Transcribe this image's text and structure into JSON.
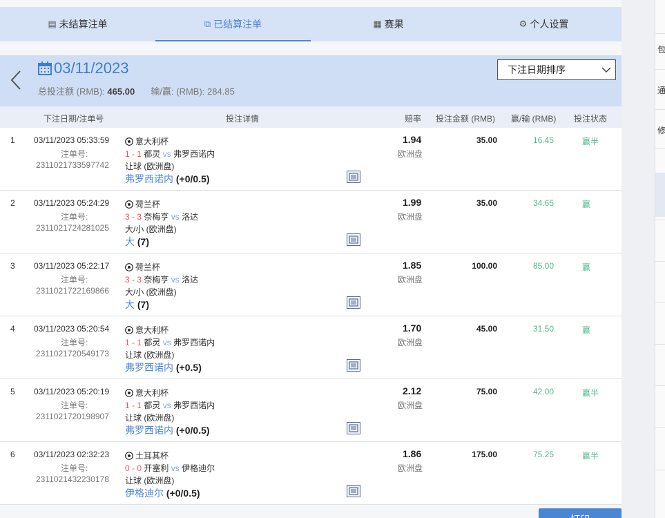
{
  "tabs": [
    {
      "label": "未结算注单",
      "icon": "unsettled-bets-icon",
      "active": false
    },
    {
      "label": "已结算注单",
      "icon": "settled-bets-icon",
      "active": true
    },
    {
      "label": "赛果",
      "icon": "results-icon",
      "active": false
    },
    {
      "label": "个人设置",
      "icon": "gear-icon",
      "active": false
    }
  ],
  "header": {
    "date": "03/11/2023",
    "total_label": "总投注额 (RMB):",
    "total_value": "465.00",
    "winloss_label": "输/赢: (RMB):",
    "winloss_value": "284.85",
    "sort_label": "下注日期排序"
  },
  "columns": {
    "date_no": "下注日期/注单号",
    "details": "投注详情",
    "odds": "赔率",
    "stake": "投注金额 (RMB)",
    "winloss": "赢/输 (RMB)",
    "status": "投注状态"
  },
  "bet_no_label": "注单号:",
  "rows": [
    {
      "index": "1",
      "datetime": "03/11/2023 05:33:59",
      "bet_no": "2311021733597742",
      "league": "意大利杯",
      "score": "1 - 1",
      "home": "都灵",
      "vs": "vs",
      "away": "弗罗西诺内",
      "market": "让球 (欧洲盘)",
      "pick": "弗罗西诺内",
      "line": "(+0/0.5)",
      "odds": "1.94",
      "odds_type": "欧洲盘",
      "stake": "35.00",
      "winloss": "16.45",
      "status": "赢半"
    },
    {
      "index": "2",
      "datetime": "03/11/2023 05:24:29",
      "bet_no": "2311021724281025",
      "league": "荷兰杯",
      "score": "3 - 3",
      "home": "奈梅亨",
      "vs": "vs",
      "away": "洛达",
      "market": "大/小 (欧洲盘)",
      "pick": "大",
      "line": "(7)",
      "odds": "1.99",
      "odds_type": "欧洲盘",
      "stake": "35.00",
      "winloss": "34.65",
      "status": "赢"
    },
    {
      "index": "3",
      "datetime": "03/11/2023 05:22:17",
      "bet_no": "2311021722169866",
      "league": "荷兰杯",
      "score": "3 - 3",
      "home": "奈梅亨",
      "vs": "vs",
      "away": "洛达",
      "market": "大/小 (欧洲盘)",
      "pick": "大",
      "line": "(7)",
      "odds": "1.85",
      "odds_type": "欧洲盘",
      "stake": "100.00",
      "winloss": "85.00",
      "status": "赢"
    },
    {
      "index": "4",
      "datetime": "03/11/2023 05:20:54",
      "bet_no": "2311021720549173",
      "league": "意大利杯",
      "score": "1 - 1",
      "home": "都灵",
      "vs": "vs",
      "away": "弗罗西诺内",
      "market": "让球 (欧洲盘)",
      "pick": "弗罗西诺内",
      "line": "(+0.5)",
      "odds": "1.70",
      "odds_type": "欧洲盘",
      "stake": "45.00",
      "winloss": "31.50",
      "status": "赢"
    },
    {
      "index": "5",
      "datetime": "03/11/2023 05:20:19",
      "bet_no": "2311021720198907",
      "league": "意大利杯",
      "score": "1 - 1",
      "home": "都灵",
      "vs": "vs",
      "away": "弗罗西诺内",
      "market": "让球 (欧洲盘)",
      "pick": "弗罗西诺内",
      "line": "(+0/0.5)",
      "odds": "2.12",
      "odds_type": "欧洲盘",
      "stake": "75.00",
      "winloss": "42.00",
      "status": "赢半"
    },
    {
      "index": "6",
      "datetime": "03/11/2023 02:32:23",
      "bet_no": "2311021432230178",
      "league": "土耳其杯",
      "score": "0 - 0",
      "home": "开塞利",
      "vs": "vs",
      "away": "伊格迪尔",
      "market": "让球 (欧洲盘)",
      "pick": "伊格迪尔",
      "line": "(+0/0.5)",
      "odds": "1.86",
      "odds_type": "欧洲盘",
      "stake": "175.00",
      "winloss": "75.25",
      "status": "赢半"
    }
  ],
  "print_label": "打印",
  "side_chars": [
    "包",
    "通",
    "修"
  ],
  "colors": {
    "accent": "#4a86d4",
    "win": "#4fb98c",
    "score": "#e55555",
    "tab_bg": "#d6e3f6",
    "date_bg": "#cfdef5"
  }
}
